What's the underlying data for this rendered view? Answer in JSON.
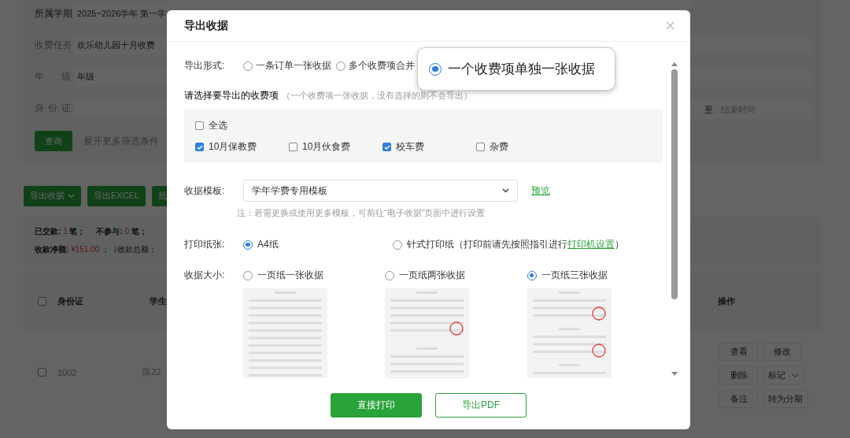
{
  "background": {
    "filters": [
      {
        "label": "所属学期",
        "value": "2025~2026学年 第一学"
      },
      {
        "label": "收费任务",
        "value": "欢乐幼儿园十月收费"
      },
      {
        "label": "年级",
        "value": "年级"
      },
      {
        "label": "身份证"
      }
    ],
    "query_button": "查询",
    "expand_link": "展开更多筛选条件",
    "actions": [
      {
        "label": "导出收据",
        "kind": "dropdown"
      },
      {
        "label": "导出EXCEL",
        "kind": "plain"
      },
      {
        "label": "批",
        "kind": "plain"
      }
    ],
    "stats": [
      {
        "label": "已交款:",
        "count": "1",
        "unit": "笔；"
      },
      {
        "label": "不参与:",
        "count": "0",
        "unit": "笔；"
      }
    ],
    "net": {
      "label": "收款净额:",
      "amount": "¥151.00",
      "suffix": "；（收款总额："
    },
    "table": {
      "all_checked": false,
      "columns": [
        "身份证",
        "学生"
      ],
      "rows": [
        {
          "checked": false,
          "cells": [
            "1002",
            "陈22"
          ]
        }
      ]
    },
    "date_range": {
      "separator": "至",
      "placeholder": "结束时间"
    },
    "ops_column": "操作",
    "row_actions": [
      [
        {
          "label": "查看",
          "kind": "plain"
        },
        {
          "label": "修改",
          "kind": "plain"
        }
      ],
      [
        {
          "label": "删除",
          "kind": "plain"
        },
        {
          "label": "标记",
          "kind": "dropdown"
        }
      ],
      [
        {
          "label": "备注",
          "kind": "plain"
        },
        {
          "label": "转为分期",
          "kind": "plain"
        }
      ]
    ]
  },
  "dialog": {
    "title": "导出收据",
    "export_format": {
      "label": "导出形式:",
      "options": [
        {
          "label": "一条订单一张收据",
          "selected": false,
          "magnified": false
        },
        {
          "label": "多个收费项合并",
          "selected": false,
          "magnified": false
        },
        {
          "label": "一个收费项单独一张收据",
          "selected": true,
          "magnified": true
        }
      ]
    },
    "fee_items": {
      "title": "请选择要导出的收费项",
      "hint": "（一个收费项一张收据，没有选择的则不会导出）",
      "select_all": {
        "label": "全选",
        "checked": false
      },
      "items": [
        {
          "label": "10月保教费",
          "checked": true
        },
        {
          "label": "10月伙食费",
          "checked": false
        },
        {
          "label": "校车费",
          "checked": true
        },
        {
          "label": "杂费",
          "checked": false
        }
      ]
    },
    "template": {
      "label": "收据模板:",
      "value": "学年学费专用模板",
      "preview_link": "预览",
      "note": "注：若需更换或使用更多模板，可前往“电子收据”页面中进行设置"
    },
    "paper": {
      "label": "打印纸张:",
      "options": [
        {
          "label": "A4纸",
          "selected": true
        },
        {
          "label": "针式打印纸（打印前请先按照指引进行",
          "link": "打印机设置",
          "suffix": "）",
          "selected": false
        }
      ]
    },
    "size": {
      "label": "收据大小:",
      "options": [
        {
          "label": "一页纸一张收据",
          "selected": false
        },
        {
          "label": "一页纸两张收据",
          "selected": false
        },
        {
          "label": "一页纸三张收据",
          "selected": true
        }
      ]
    },
    "buttons": [
      {
        "label": "直接打印",
        "kind": "primary"
      },
      {
        "label": "导出PDF",
        "kind": "outline"
      }
    ]
  }
}
